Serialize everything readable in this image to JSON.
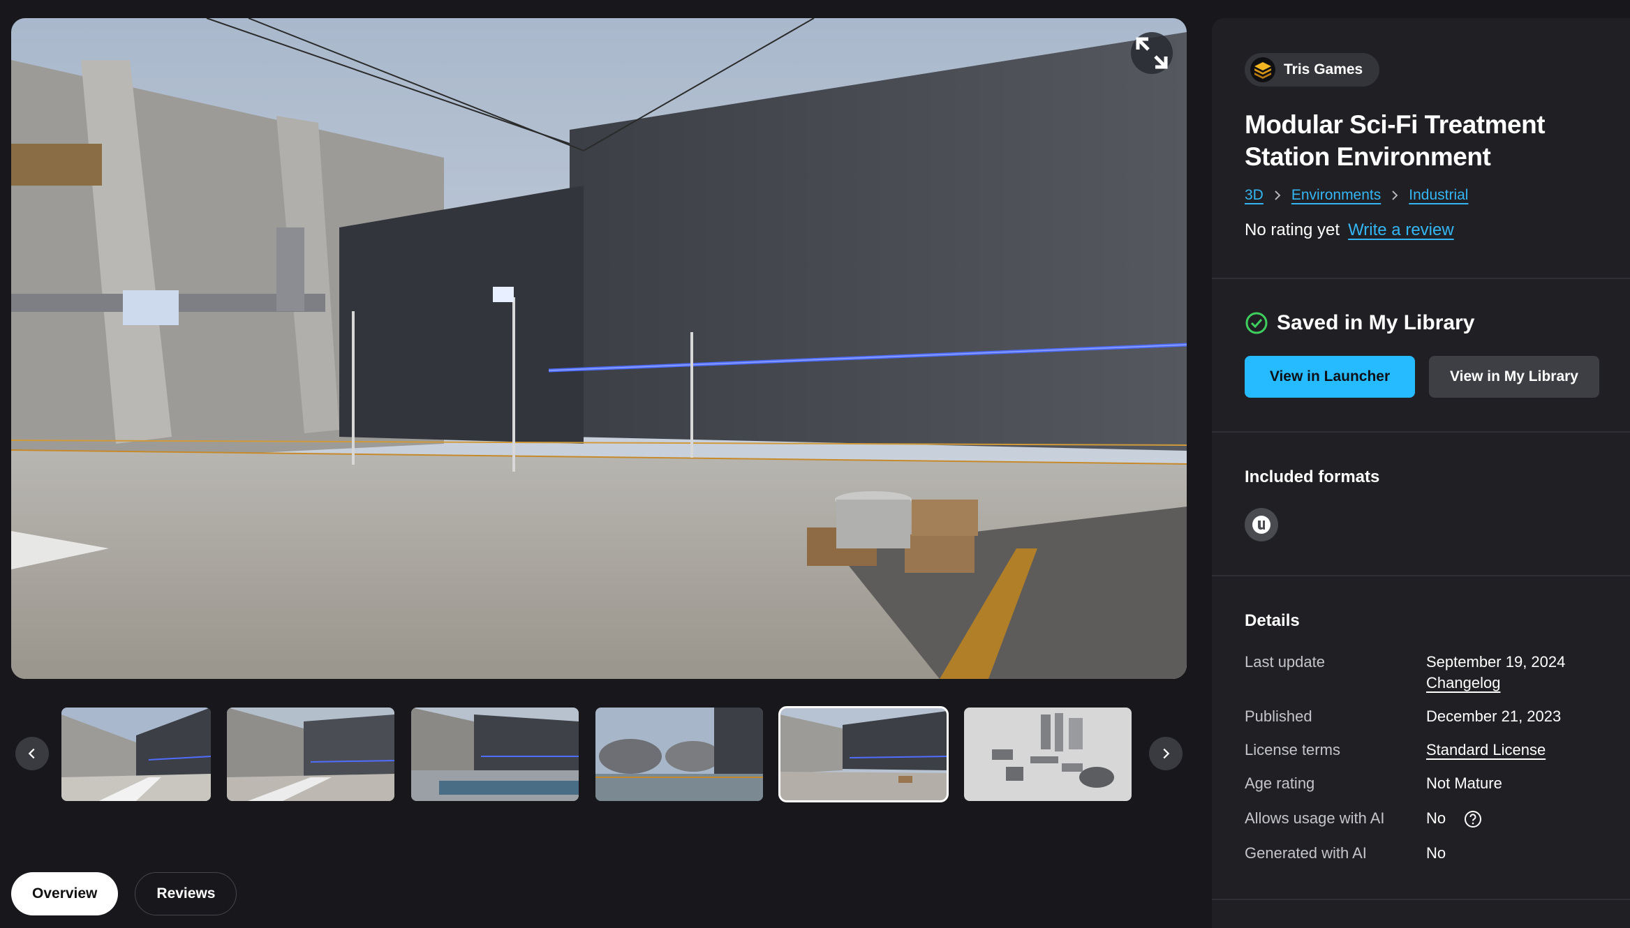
{
  "hero": {
    "fullscreen_icon": "expand-icon"
  },
  "gallery": {
    "prev_icon": "chevron-left-icon",
    "next_icon": "chevron-right-icon",
    "active_index": 4,
    "thumbnail_count": 6
  },
  "tabs": [
    {
      "label": "Overview",
      "active": true
    },
    {
      "label": "Reviews",
      "active": false
    }
  ],
  "seller": {
    "name": "Tris Games",
    "logo": "tris-games-logo"
  },
  "product": {
    "title_line1": "Modular Sci-Fi Treatment",
    "title_line2": "Station Environment",
    "breadcrumbs": [
      "3D",
      "Environments",
      "Industrial"
    ],
    "rating_text": "No rating yet",
    "write_review": "Write a review"
  },
  "library": {
    "status": "Saved in My Library",
    "status_icon": "check-circle-icon",
    "primary_button": "View in Launcher",
    "secondary_button": "View in My Library"
  },
  "formats": {
    "title": "Included formats",
    "items": [
      {
        "icon": "unreal-engine-icon"
      }
    ]
  },
  "details": {
    "title": "Details",
    "rows": [
      {
        "key": "Last update",
        "value": "September 19, 2024",
        "extra_link": "Changelog"
      },
      {
        "key": "Published",
        "value": "December 21, 2023"
      },
      {
        "key": "License terms",
        "value": "Standard License",
        "is_link": true
      },
      {
        "key": "Age rating",
        "value": "Not Mature"
      },
      {
        "key": "Allows usage with AI",
        "value": "No",
        "help_icon": "question-circle-icon"
      },
      {
        "key": "Generated with AI",
        "value": "No"
      }
    ]
  },
  "colors": {
    "accent": "#26bbff",
    "link": "#35b6f4",
    "success": "#3ecf5e",
    "background": "#18181c",
    "panel": "#202024"
  }
}
